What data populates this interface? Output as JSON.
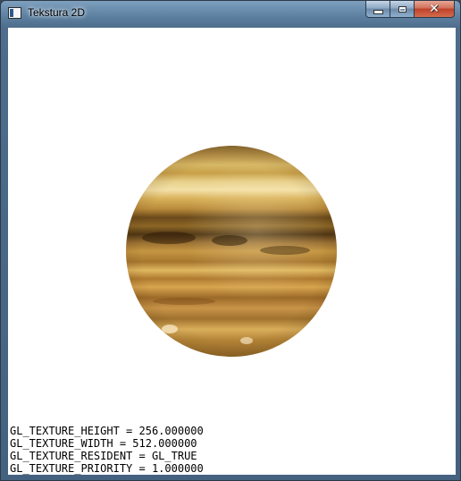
{
  "window": {
    "title": "Tekstura 2D",
    "close_glyph": "✕"
  },
  "hud": {
    "lines": [
      "GL_TEXTURE_HEIGHT = 256.000000",
      "GL_TEXTURE_WIDTH = 512.000000",
      "GL_TEXTURE_RESIDENT = GL_TRUE",
      "GL_TEXTURE_PRIORITY = 1.000000"
    ]
  },
  "colors": {
    "client_background": "#ffffff",
    "hud_text": "#000000",
    "close_button": "#c0412a"
  }
}
